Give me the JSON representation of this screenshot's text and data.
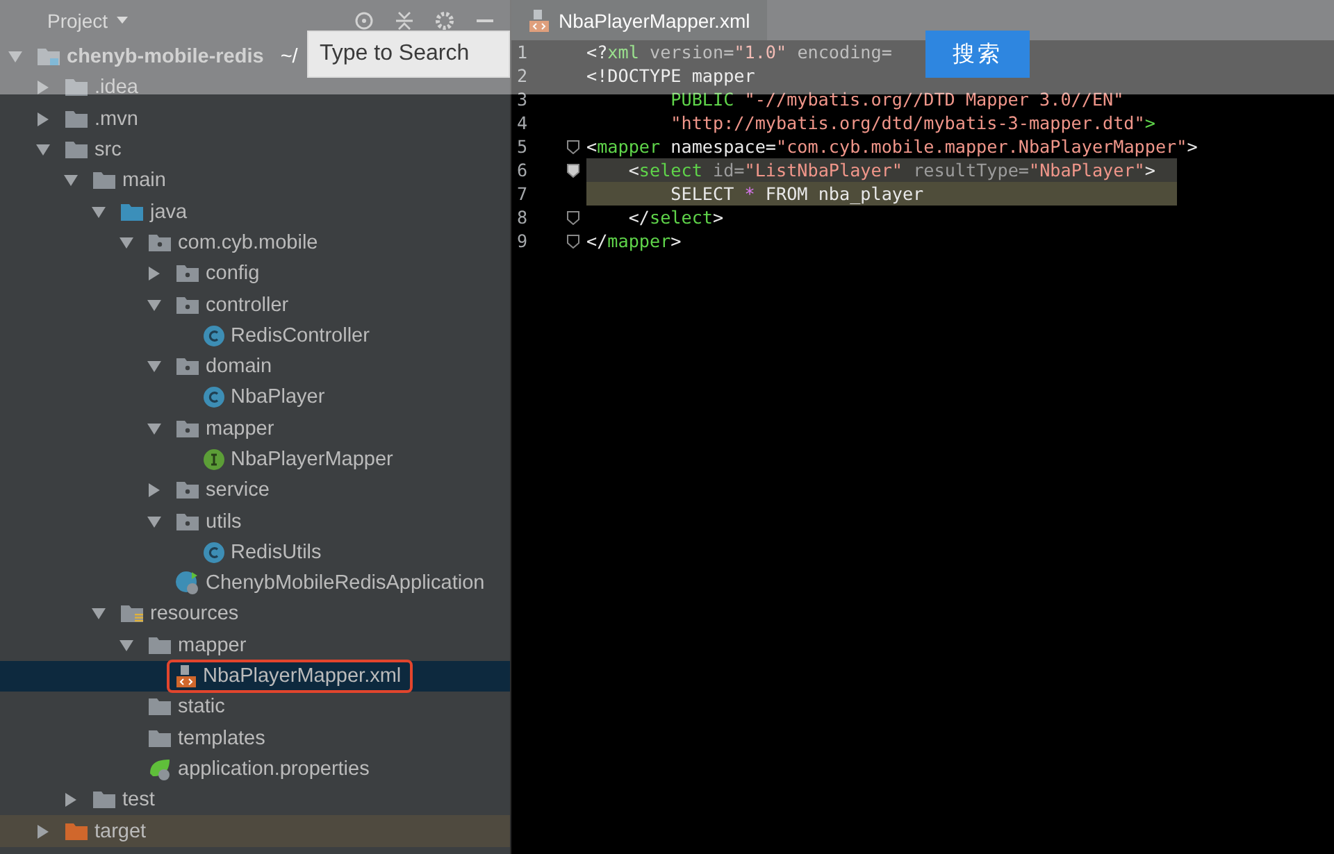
{
  "project_panel": {
    "title": "Project",
    "tree": [
      {
        "label": "chenyb-mobile-redis",
        "path": "~/",
        "kind": "module",
        "expanded": true,
        "selected": false,
        "children": [
          {
            "label": ".idea",
            "kind": "folder",
            "expanded": false,
            "selected": false
          },
          {
            "label": ".mvn",
            "kind": "folder",
            "expanded": false,
            "selected": false
          },
          {
            "label": "src",
            "kind": "folder",
            "expanded": true,
            "selected": false,
            "children": [
              {
                "label": "main",
                "kind": "folder",
                "expanded": true,
                "selected": false,
                "children": [
                  {
                    "label": "java",
                    "kind": "source-folder",
                    "expanded": true,
                    "selected": false,
                    "children": [
                      {
                        "label": "com.cyb.mobile",
                        "kind": "package",
                        "expanded": true,
                        "selected": false,
                        "children": [
                          {
                            "label": "config",
                            "kind": "package",
                            "expanded": false,
                            "selected": false
                          },
                          {
                            "label": "controller",
                            "kind": "package",
                            "expanded": true,
                            "selected": false,
                            "children": [
                              {
                                "label": "RedisController",
                                "kind": "class",
                                "selected": false
                              }
                            ]
                          },
                          {
                            "label": "domain",
                            "kind": "package",
                            "expanded": true,
                            "selected": false,
                            "children": [
                              {
                                "label": "NbaPlayer",
                                "kind": "class",
                                "selected": false
                              }
                            ]
                          },
                          {
                            "label": "mapper",
                            "kind": "package",
                            "expanded": true,
                            "selected": false,
                            "children": [
                              {
                                "label": "NbaPlayerMapper",
                                "kind": "interface",
                                "selected": false
                              }
                            ]
                          },
                          {
                            "label": "service",
                            "kind": "package",
                            "expanded": false,
                            "selected": false
                          },
                          {
                            "label": "utils",
                            "kind": "package",
                            "expanded": true,
                            "selected": false,
                            "children": [
                              {
                                "label": "RedisUtils",
                                "kind": "class",
                                "selected": false
                              }
                            ]
                          },
                          {
                            "label": "ChenybMobileRedisApplication",
                            "kind": "spring-app",
                            "selected": false
                          }
                        ]
                      }
                    ]
                  },
                  {
                    "label": "resources",
                    "kind": "resources-folder",
                    "expanded": true,
                    "selected": false,
                    "children": [
                      {
                        "label": "mapper",
                        "kind": "folder",
                        "expanded": true,
                        "selected": false,
                        "children": [
                          {
                            "label": "NbaPlayerMapper.xml",
                            "kind": "xml",
                            "selected": true,
                            "annotated": true
                          }
                        ]
                      },
                      {
                        "label": "static",
                        "kind": "folder",
                        "selected": false
                      },
                      {
                        "label": "templates",
                        "kind": "folder",
                        "selected": false
                      },
                      {
                        "label": "application.properties",
                        "kind": "properties",
                        "selected": false
                      }
                    ]
                  }
                ]
              },
              {
                "label": "test",
                "kind": "folder",
                "expanded": false,
                "selected": false
              }
            ]
          },
          {
            "label": "target",
            "kind": "excluded-folder",
            "expanded": false,
            "selected": false
          }
        ]
      }
    ]
  },
  "editor": {
    "tab": "NbaPlayerMapper.xml",
    "lines": [
      {
        "number": "1",
        "current": false,
        "injected": false,
        "tokens": [
          {
            "kind": "punct",
            "text": "<?"
          },
          {
            "kind": "tag",
            "text": "xml "
          },
          {
            "kind": "attr",
            "text": "version="
          },
          {
            "kind": "string",
            "text": "\"1.0\" "
          },
          {
            "kind": "attr",
            "text": "encoding="
          }
        ]
      },
      {
        "number": "2",
        "current": false,
        "injected": false,
        "tokens": [
          {
            "kind": "punct",
            "text": "<!DOCTYPE mapper"
          }
        ]
      },
      {
        "number": "3",
        "current": false,
        "injected": false,
        "tokens": [
          {
            "kind": "tag",
            "text": "        PUBLIC "
          },
          {
            "kind": "string",
            "text": "\"-//mybatis.org//DTD Mapper 3.0//EN\""
          }
        ]
      },
      {
        "number": "4",
        "current": false,
        "injected": false,
        "tokens": [
          {
            "kind": "string",
            "text": "        \"http://mybatis.org/dtd/mybatis-3-mapper.dtd\""
          },
          {
            "kind": "tag",
            "text": ">"
          }
        ]
      },
      {
        "number": "5",
        "current": false,
        "injected": false,
        "tokens": [
          {
            "kind": "punct",
            "text": "<"
          },
          {
            "kind": "tag",
            "text": "mapper "
          },
          {
            "kind": "plain",
            "text": "namespace="
          },
          {
            "kind": "string",
            "text": "\"com.cyb.mobile.mapper.NbaPlayerMapper\""
          },
          {
            "kind": "punct",
            "text": ">"
          }
        ]
      },
      {
        "number": "6",
        "current": true,
        "injected": false,
        "tokens": [
          {
            "kind": "punct",
            "text": "    <"
          },
          {
            "kind": "tag",
            "text": "select "
          },
          {
            "kind": "attr",
            "text": "id="
          },
          {
            "kind": "string",
            "text": "\"ListNbaPlayer\" "
          },
          {
            "kind": "attr",
            "text": "resultType="
          },
          {
            "kind": "string",
            "text": "\"NbaPlayer\""
          },
          {
            "kind": "punct",
            "text": ">"
          }
        ]
      },
      {
        "number": "7",
        "current": false,
        "injected": true,
        "tokens": [
          {
            "kind": "plain",
            "text": "        SELECT "
          },
          {
            "kind": "operator",
            "text": "*"
          },
          {
            "kind": "plain",
            "text": " FROM nba_player"
          }
        ]
      },
      {
        "number": "8",
        "current": false,
        "injected": false,
        "tokens": [
          {
            "kind": "punct",
            "text": "    </"
          },
          {
            "kind": "tag",
            "text": "select"
          },
          {
            "kind": "punct",
            "text": ">"
          }
        ]
      },
      {
        "number": "9",
        "current": false,
        "injected": false,
        "tokens": [
          {
            "kind": "punct",
            "text": "</"
          },
          {
            "kind": "tag",
            "text": "mapper"
          },
          {
            "kind": "punct",
            "text": ">"
          }
        ]
      }
    ]
  },
  "search_bar": {
    "placeholder": "Type to Search",
    "button": "搜索"
  }
}
